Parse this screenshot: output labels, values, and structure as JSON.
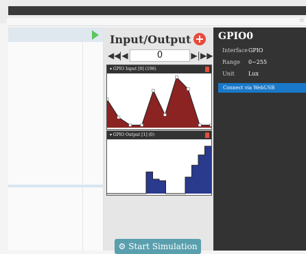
{
  "io_panel": {
    "title": "Input/Output",
    "add_symbol": "+",
    "counter_value": "0",
    "nav": {
      "first": "◀◀",
      "prev": "|◀",
      "next": "▶|",
      "last": "▶▶"
    }
  },
  "charts": [
    {
      "title": "▾ GPIO Input [0] (196)"
    },
    {
      "title": "▾ GPIO Output [1] (0)"
    }
  ],
  "chart_data": [
    {
      "type": "area",
      "values": [
        0.55,
        0.2,
        0.05,
        0.05,
        0.72,
        0.25,
        0.98,
        0.75,
        0.05,
        0.05
      ],
      "color": "#8b2323",
      "ylim": [
        0,
        1
      ]
    },
    {
      "type": "area",
      "step": true,
      "values": [
        0,
        0,
        0,
        0,
        0,
        0,
        0.42,
        0.28,
        0.25,
        0,
        0,
        0,
        0.32,
        0.55,
        0.75,
        0.92
      ],
      "color": "#2a3a8c",
      "ylim": [
        0,
        1
      ]
    }
  ],
  "start_button": {
    "label": "Start Simulation"
  },
  "gpio_panel": {
    "title": "GPIO0",
    "properties": [
      {
        "key": "Interface",
        "value": "GPIO"
      },
      {
        "key": "Range",
        "value": "0~255"
      },
      {
        "key": "Unit",
        "value": "Lux"
      }
    ],
    "connect_label": "Connect via WebUSB"
  },
  "colors": {
    "accent": "#1978c8",
    "add_red": "#e84a3c",
    "start_teal": "#5a9fae"
  }
}
